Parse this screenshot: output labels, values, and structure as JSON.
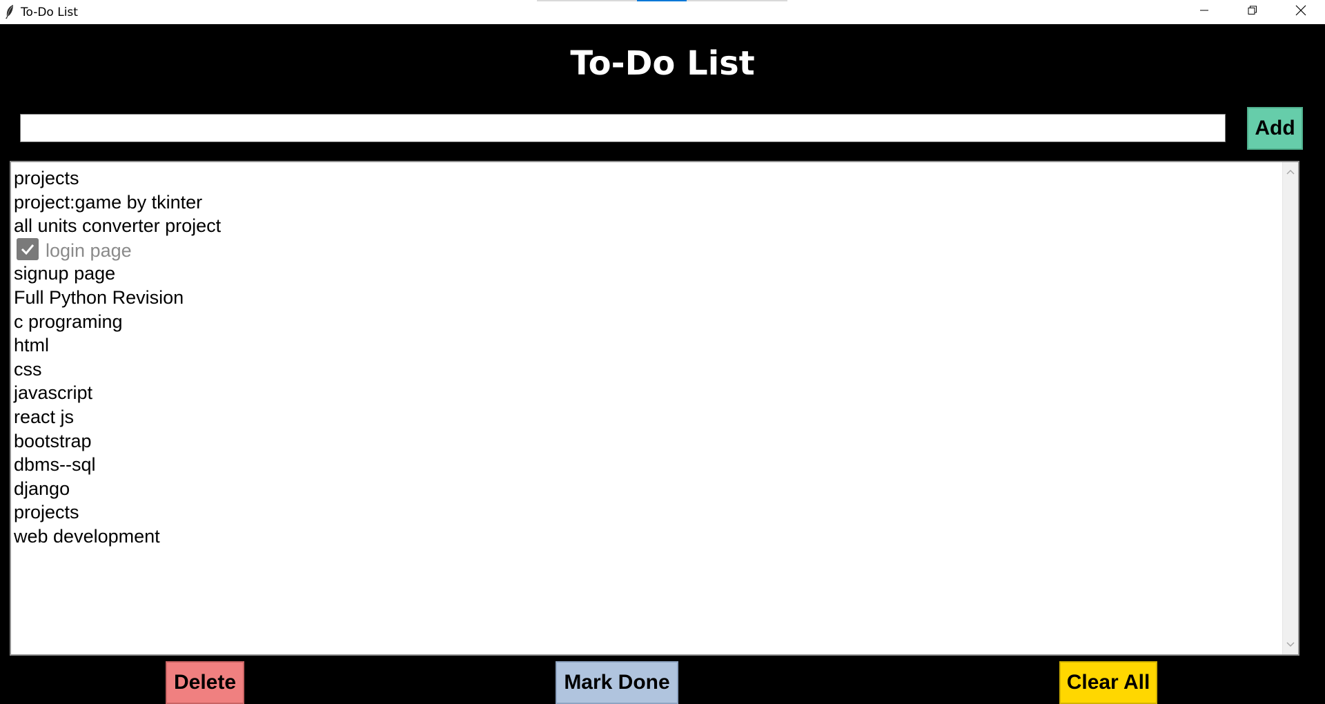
{
  "window": {
    "title": "To-Do List",
    "controls": {
      "minimize": "minimize-icon",
      "maximize": "restore-icon",
      "close": "close-icon"
    }
  },
  "header": {
    "title": "To-Do List"
  },
  "input": {
    "value": "",
    "placeholder": ""
  },
  "buttons": {
    "add": "Add",
    "delete": "Delete",
    "mark_done": "Mark Done",
    "clear_all": "Clear All"
  },
  "tasks": [
    {
      "text": "projects",
      "done": false
    },
    {
      "text": "project:game by tkinter",
      "done": false
    },
    {
      "text": "all units converter project",
      "done": false
    },
    {
      "text": "login page",
      "done": true
    },
    {
      "text": "signup page",
      "done": false
    },
    {
      "text": "Full Python Revision",
      "done": false
    },
    {
      "text": "c programing",
      "done": false
    },
    {
      "text": "html",
      "done": false
    },
    {
      "text": "css",
      "done": false
    },
    {
      "text": "javascript",
      "done": false
    },
    {
      "text": "react js",
      "done": false
    },
    {
      "text": "bootstrap",
      "done": false
    },
    {
      "text": "dbms--sql",
      "done": false
    },
    {
      "text": "django",
      "done": false
    },
    {
      "text": "projects",
      "done": false
    },
    {
      "text": "web development",
      "done": false
    }
  ],
  "colors": {
    "background": "#000000",
    "add_button": "#66cdaa",
    "delete_button": "#f08080",
    "mark_done_button": "#b0c4de",
    "clear_all_button": "#ffd700",
    "done_text": "#8a8a8a"
  }
}
